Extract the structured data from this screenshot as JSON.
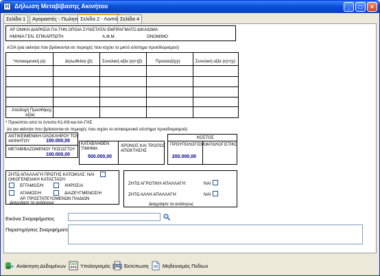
{
  "window": {
    "title": "Δήλωση Μεταβίβασης Ακινήτου"
  },
  "tabs": [
    {
      "label": "Σελίδα 1"
    },
    {
      "label": "Αγοραστές - Πωλητές"
    },
    {
      "label": "Σελίδα 2 - Λοιπά"
    },
    {
      "label": "Σελίδα 4"
    }
  ],
  "header_box": {
    "line1": "ΧΡ ΟΝΙΚΗ ΔΙΑΡΚΕΙΑ ΓΙΑ ΤΗΝ ΟΠΟΙΑ ΣΥΝΙΣΤΑΤΑΙ ΕΜΠΡΑΓΜΑΤΟ ΔΙΚΑΙΩΜΑ:",
    "line2a": "ΗΜ/ΝΙΑ ΓΕΝ. ΕΠΙΚΑΡΠΩΤΗ",
    "line2b": "Α.Φ.Μ.",
    "line2c": "ΟΝΟΜ/ΜΟ"
  },
  "axia": {
    "heading": "ΑΞΙΑ (για ακίνητα που βρίσκονται σε περιοχές που ισχύει το μικτό σύστημα προσδιορισμού)",
    "columns": [
      "*Αντικειμενική (α)",
      "Δηλωθείσα (β)",
      "Συνολική αξία (α)+(β)",
      "Προσαυξη(γ)",
      "Συνολική αξία (α)+(γ)"
    ],
    "footer_label_1": "Αποδοχή Προσθήκης",
    "footer_label_2": "αξίας",
    "note": "* Προκύπτει από το έντυπο Κ1-Κ9 και ΑΑ-ΓΗΣ",
    "note2": "(ια για ακίνητα που βρίσκονται σε περιοχές που ισχύει το αντικειμενικό σύστημα προσδιορισμού)"
  },
  "values": {
    "antikeimeniki_label_1": "ΑΝΤΙΚΕΙΜΕΝΙΚΗ ΟΛΟΚΛΗΡΟΥ ΤΟΥ",
    "antikeimeniki_label_2": "ΑΚΙΝΗΤΟΥ",
    "antikeimeniki_value": "100.000,00",
    "metavivazomenou_label": "ΜΕΤΑΒΙΒΑΖΟΜΕΝΟΥ ΠΟΣΟΣΤΟΥ",
    "metavivazomenou_value": "100.000,00",
    "katavlithen_label_1": "ΚΑΤΑΒΛΗΘΕΝ",
    "katavlithen_label_2": "ΤΙΜΗΜΑ",
    "katavlithen_value": "500.000,00",
    "xronos_label_1": "ΧΡΟΝΟΣ ΚΑΙ ΤΡΟΠΟΣ",
    "xronos_label_2": "ΑΠΟΚΤΗΣΗΣ",
    "kostos_label": "ΚΟΣΤΟΣ",
    "proypologismo_label": "ΠΡΟΥΠΟΛΟΓΙΣΜΟ",
    "apologistiko_label": "ΑΠΟΛΟΓΙΣΤΙΚΟ",
    "proypologismo_value": "200.000,00"
  },
  "left_group": {
    "zitw_label": "ΖΗΤΩ ΑΠΑΛΛΑΓΗ ΠΡΩΤΗΣ ΚΑΤΟΙΚΙΑΣ: ΝΑΙ",
    "oikog_label": "ΟΙΚΟΓΕΝΕΙΑΚΗ ΚΑΤΑΣΤΑΣΗ:",
    "eggamos": "ΕΓΓΑΜΟΣ/Η",
    "xiros": "ΧΗΡΟΣ/Α",
    "agamos": "ΑΓΑΜΟΣ/Η",
    "diazeugmenos": "ΔΙΑΖΕΥΓΜΕΝΟΣ/Η",
    "ar_paidion": "ΑΡ. ΠΡΟΣΤΑΤΕΥΟΜΕΝΩΝ ΠΑΙΔΙΩΝ",
    "note": "Διαγράψτε τα ανάλογως"
  },
  "right_group": {
    "agrotiki_label": "ΖΗΤΩ ΑΓΡΟΤΙΚΗ ΑΠΑΛΛΑΓΗ:",
    "agrotiki_nai": "ΝΑΙ",
    "alli_label": "ΖΗΤΩ ΑΛΛΗ ΑΠΑΛΛΑΓΗ:",
    "alli_nai": "ΝΑΙ",
    "note": "Διαγράψτε τα ανάλογως"
  },
  "sketch": {
    "image_label": "Εικόνα Σκαριφήματος",
    "image_value": "",
    "remarks_label": "Παρατηρήσεις Σκαριφήματος",
    "remarks_value": ""
  },
  "toolbar": {
    "retrieve": "Ανάκτηση Δεδομένων",
    "calculate": "Υπολογισμός",
    "print": "Εκτύπωση",
    "reset": "Μηδενισμός Πεδίων"
  }
}
